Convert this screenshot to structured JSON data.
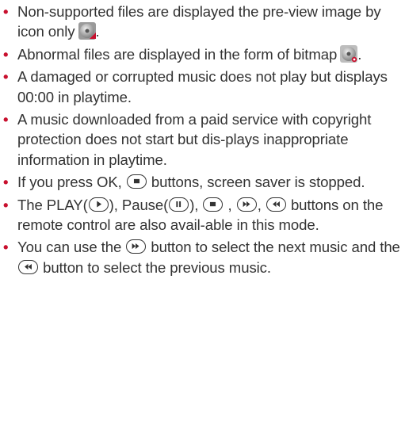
{
  "items": [
    {
      "parts": [
        "Non-supported files are displayed the pre-view image by icon only",
        "."
      ]
    },
    {
      "parts": [
        "Abnormal files are displayed in the form of bitmap",
        "."
      ]
    },
    {
      "parts": [
        "A damaged or corrupted music does not play but displays 00:00 in playtime."
      ]
    },
    {
      "parts": [
        "A music downloaded from a paid service with copyright protection does not start but dis-plays inappropriate information in playtime."
      ]
    },
    {
      "parts": [
        "If you press OK,",
        "buttons, screen saver is stopped."
      ]
    },
    {
      "parts": [
        "The PLAY(",
        "), Pause(",
        "),",
        ",",
        ",",
        "buttons on the remote control are also avail-able in this mode."
      ]
    },
    {
      "parts": [
        "You can use the",
        "button to select the next music and the",
        "button to select the previous music."
      ]
    }
  ],
  "bullet": "•",
  "icons": {
    "unsupported": "disc-unsupported-icon",
    "abnormal": "disc-abnormal-icon",
    "stop": "stop-button-icon",
    "play": "play-button-icon",
    "pause": "pause-button-icon",
    "fastforward": "fast-forward-button-icon",
    "rewind": "rewind-button-icon"
  },
  "colors": {
    "bullet": "#c8102e",
    "text": "#333333"
  }
}
